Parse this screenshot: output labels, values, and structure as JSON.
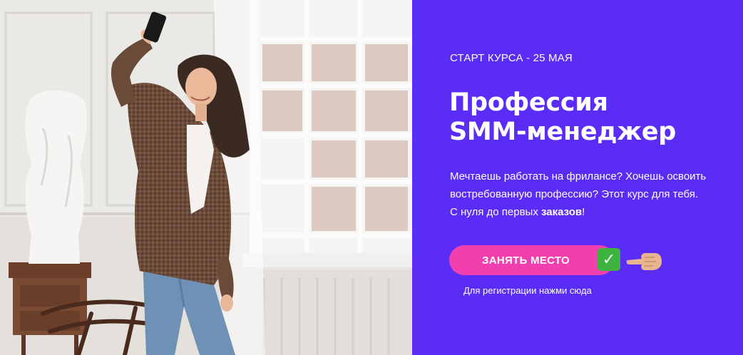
{
  "course": {
    "start_label": "СТАРТ КУРСА - 25 МАЯ",
    "title_line1": "Профессия",
    "title_line2": "SMM-менеджер",
    "description_line1": "Мечтаешь работать на фрилансе? Хочешь освоить",
    "description_line2": "востребованную профессию? Этот курс для тебя.",
    "description_line3_prefix": "С нуля до первых ",
    "description_line3_bold": "заказов",
    "description_line3_suffix": "!"
  },
  "cta": {
    "button_label": "ЗАНЯТЬ МЕСТО",
    "check_icon": "check-mark-button-icon",
    "pointer_icon": "pointing-hand-icon",
    "note": "Для регистрации нажми сюда"
  },
  "colors": {
    "panel_bg": "#5a2cf5",
    "button_bg": "#f23fb0",
    "check_bg": "#3fb33f",
    "text": "#ffffff"
  },
  "photo": {
    "description_icon": "woman-taking-selfie-photo"
  }
}
